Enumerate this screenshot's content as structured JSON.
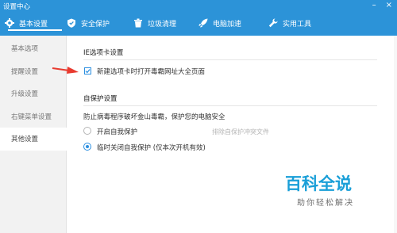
{
  "window": {
    "title": "设置中心"
  },
  "tabs": [
    {
      "label": "基本设置",
      "icon": "gear-icon"
    },
    {
      "label": "安全保护",
      "icon": "shield-icon"
    },
    {
      "label": "垃圾清理",
      "icon": "trash-icon"
    },
    {
      "label": "电脑加速",
      "icon": "rocket-icon"
    },
    {
      "label": "实用工具",
      "icon": "wrench-icon"
    }
  ],
  "sidebar": {
    "items": [
      {
        "label": "基本选项"
      },
      {
        "label": "提醒设置"
      },
      {
        "label": "升级设置"
      },
      {
        "label": "右键菜单设置"
      },
      {
        "label": "其他设置"
      }
    ]
  },
  "ie_section": {
    "title": "IE选项卡设置",
    "option_label": "新建选项卡时打开毒霸网址大全页面",
    "checked": true
  },
  "protect_section": {
    "title": "自保护设置",
    "description": "防止病毒程序破坏金山毒霸，保护您的电脑安全",
    "options": [
      {
        "label": "开启自我保护",
        "checked": false
      },
      {
        "label": "临时关闭自我保护 (仅本次开机有效)",
        "checked": true
      }
    ],
    "link_text": "排除自保护冲突文件"
  },
  "watermark": {
    "title": "百科全说",
    "subtitle": "助你轻松解决"
  },
  "colors": {
    "accent": "#2c93d8",
    "arrow": "#e83a2f",
    "watermark": "#1a9fd8"
  }
}
